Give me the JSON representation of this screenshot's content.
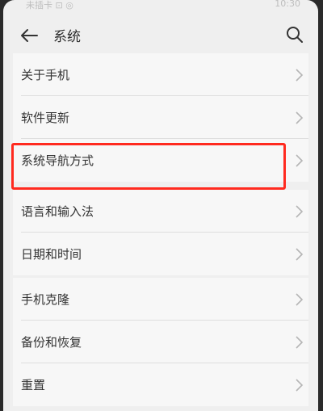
{
  "status": {
    "carrier": "未插卡 ⊡ ◎",
    "time": "10:30"
  },
  "header": {
    "title": "系统"
  },
  "groups": [
    {
      "items": [
        {
          "label": "关于手机"
        },
        {
          "label": "软件更新"
        },
        {
          "label": "系统导航方式"
        }
      ]
    },
    {
      "items": [
        {
          "label": "语言和输入法"
        },
        {
          "label": "日期和时间"
        }
      ]
    },
    {
      "items": [
        {
          "label": "手机克隆"
        },
        {
          "label": "备份和恢复"
        },
        {
          "label": "重置"
        }
      ]
    }
  ],
  "colors": {
    "highlight": "#ff2a1f",
    "background": "#efefef"
  },
  "icons": {
    "back": "arrow-left-icon",
    "search": "search-icon",
    "row": "chevron-right-icon"
  }
}
